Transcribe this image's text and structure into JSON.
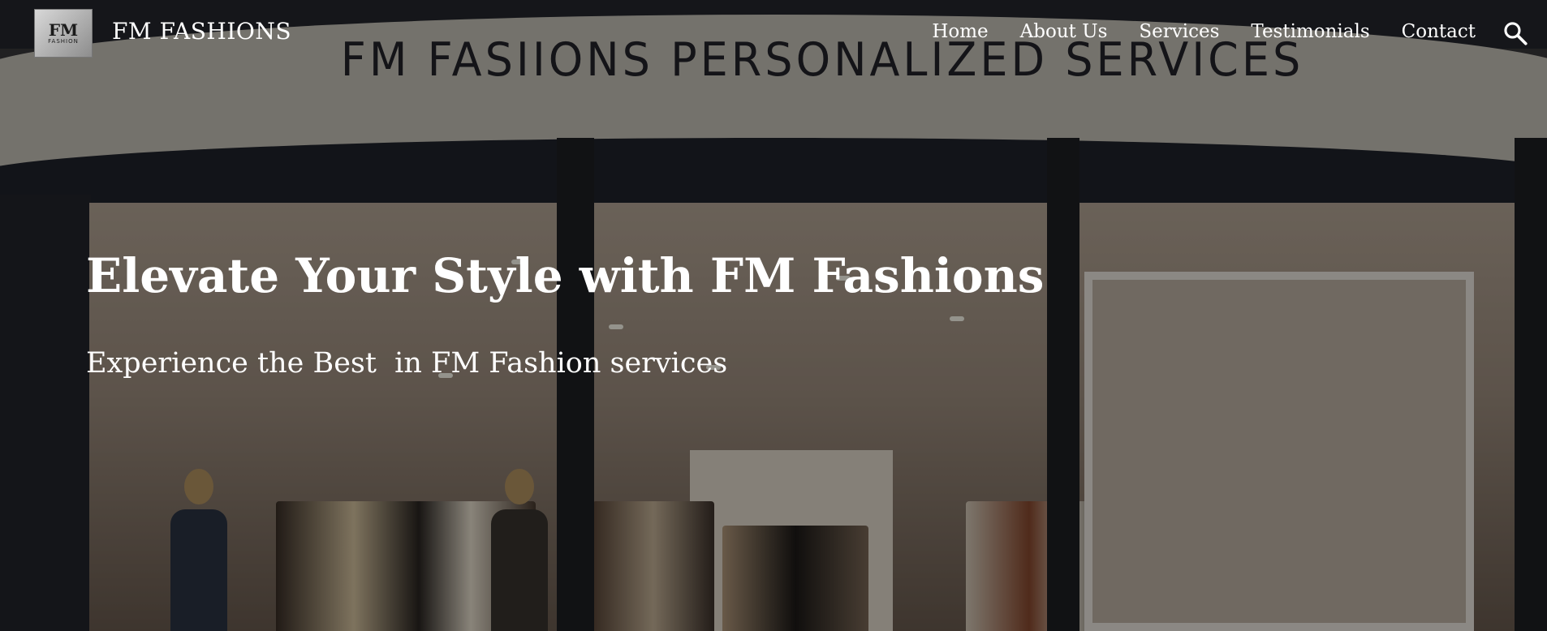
{
  "header": {
    "logo_lettering": "FM FASHION",
    "logo_mark": "FM",
    "logo_sub": "FASHION",
    "site_title": "FM FASHIONS",
    "nav": [
      {
        "label": "Home"
      },
      {
        "label": "About Us"
      },
      {
        "label": "Services"
      },
      {
        "label": "Testimonials"
      },
      {
        "label": "Contact"
      }
    ],
    "search_icon": "search-icon"
  },
  "hero": {
    "storefront_sign": "FM FASIIONS PERSONALIZED SERVICES",
    "title": "Elevate Your Style with FM Fashions",
    "subtitle": "Experience the Best  in FM Fashion services"
  },
  "colors": {
    "text": "#ffffff",
    "overlay": "#000000",
    "sign_band": "#c9c4bb"
  }
}
